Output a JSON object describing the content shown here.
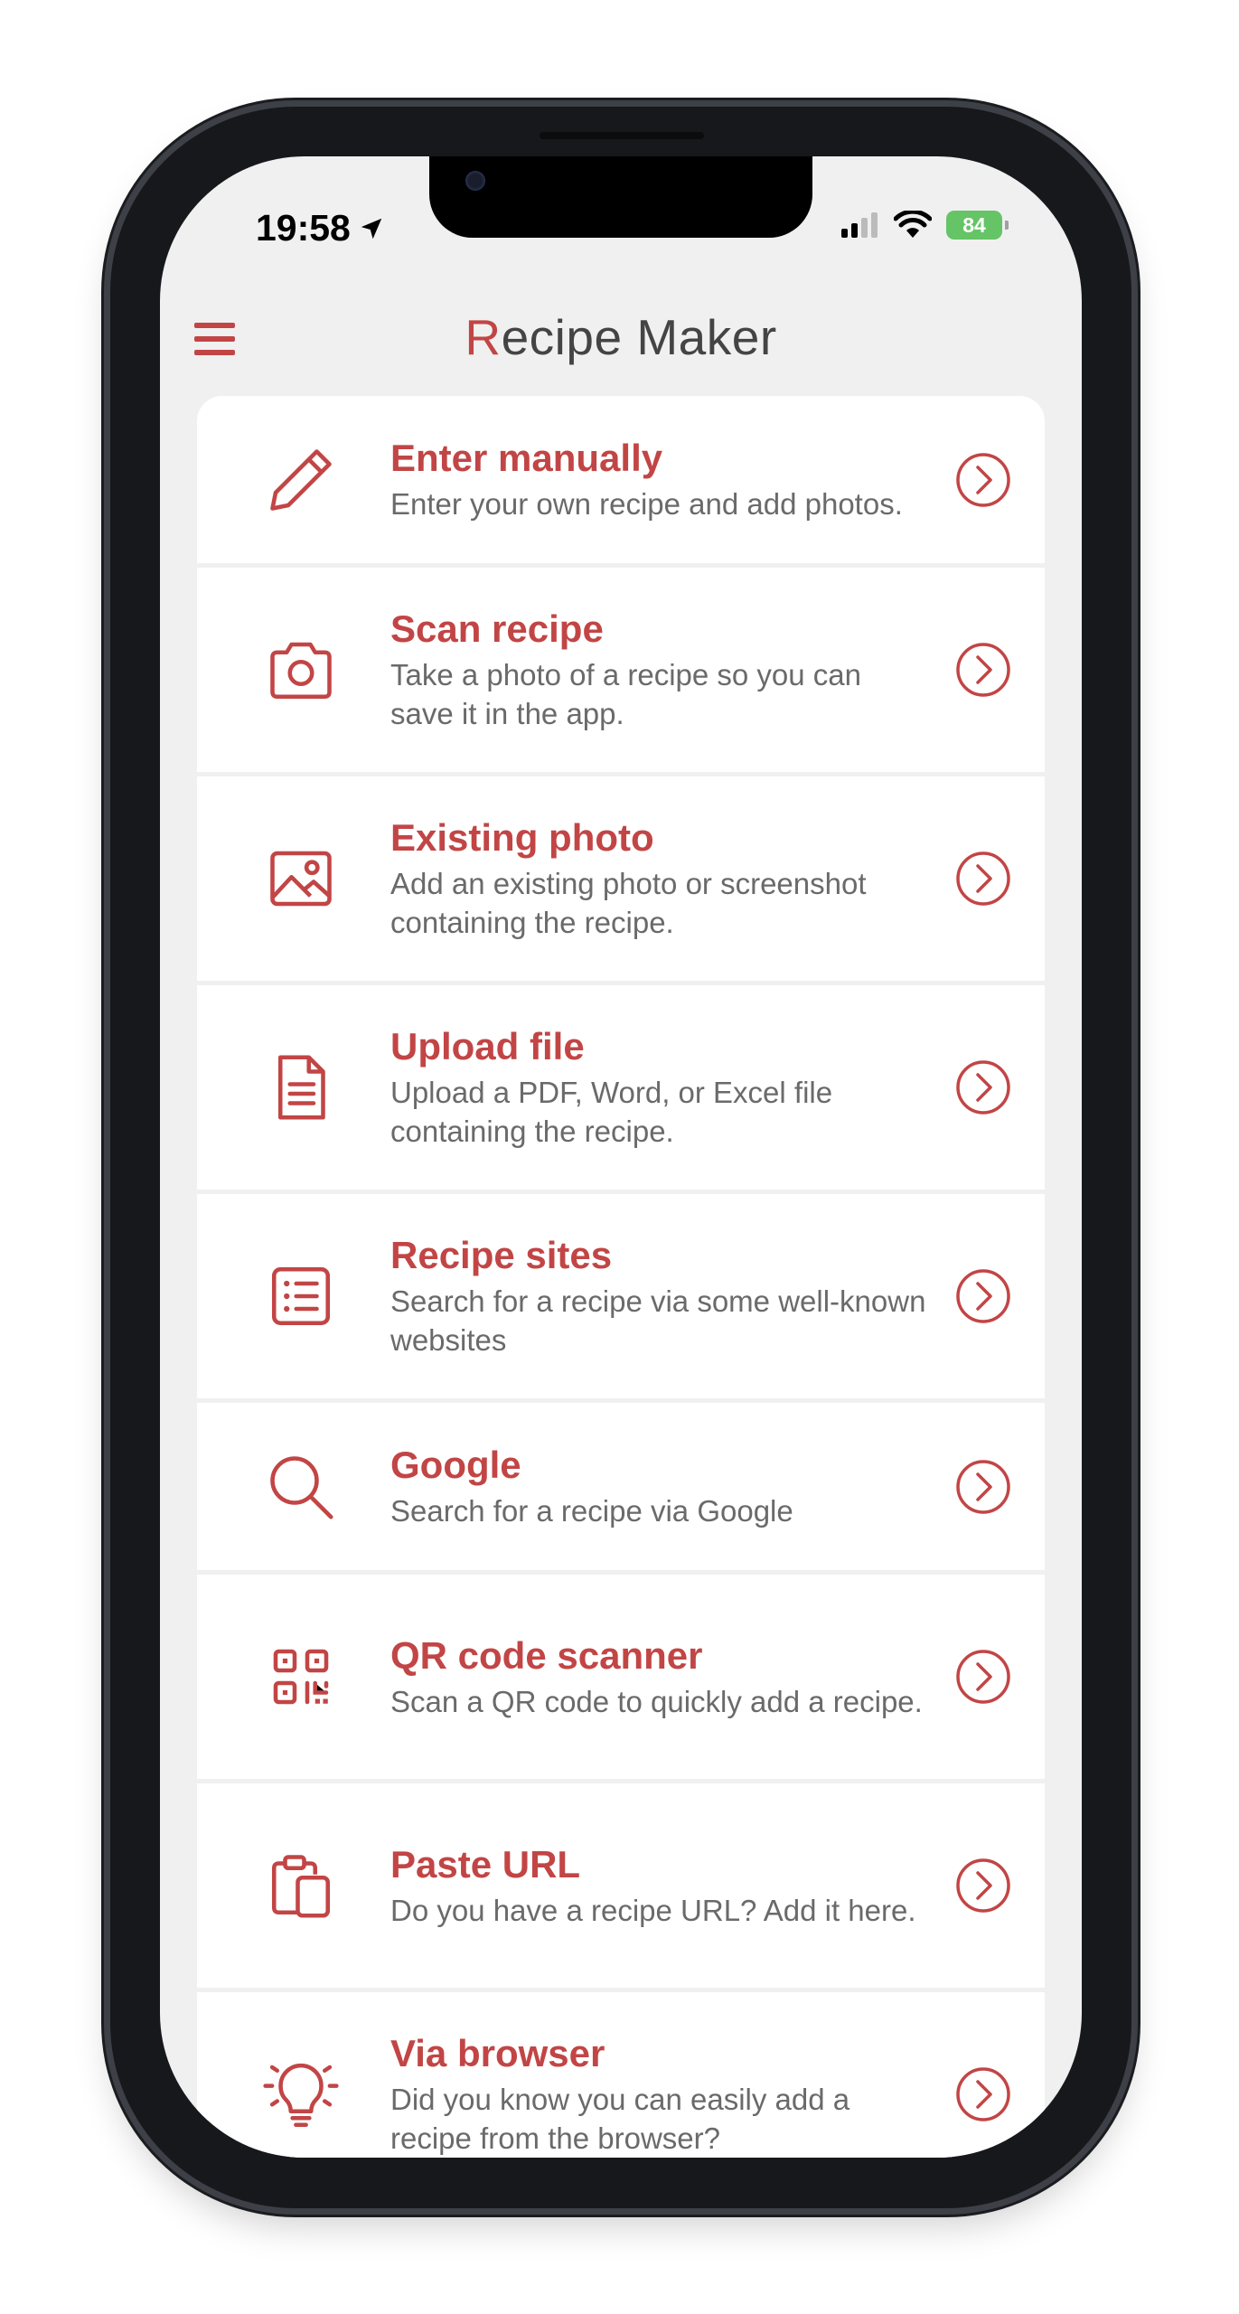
{
  "status_bar": {
    "time": "19:58",
    "battery": "84"
  },
  "header": {
    "title_initial": "R",
    "title_rest": "ecipe Maker"
  },
  "colors": {
    "accent": "#c24545",
    "background": "#f0f0f0",
    "card": "#ffffff"
  },
  "items": [
    {
      "icon": "pencil-icon",
      "name": "Enter manually",
      "desc": "Enter your own recipe and add photos."
    },
    {
      "icon": "camera-icon",
      "name": "Scan recipe",
      "desc": "Take a photo of a recipe so you can save it in the app."
    },
    {
      "icon": "image-icon",
      "name": "Existing photo",
      "desc": "Add an existing photo or screenshot containing the recipe."
    },
    {
      "icon": "file-icon",
      "name": "Upload file",
      "desc": "Upload a PDF, Word, or Excel file containing the recipe."
    },
    {
      "icon": "list-icon",
      "name": "Recipe sites",
      "desc": "Search for a recipe via some well-known websites"
    },
    {
      "icon": "search-icon",
      "name": "Google",
      "desc": "Search for a recipe via Google"
    },
    {
      "icon": "qr-code-icon",
      "name": "QR code scanner",
      "desc": "Scan a QR code to quickly add a recipe."
    },
    {
      "icon": "clipboard-icon",
      "name": "Paste URL",
      "desc": "Do you have a recipe URL? Add it here."
    },
    {
      "icon": "lightbulb-icon",
      "name": "Via browser",
      "desc": "Did you know you can easily add a recipe from the browser?"
    }
  ]
}
